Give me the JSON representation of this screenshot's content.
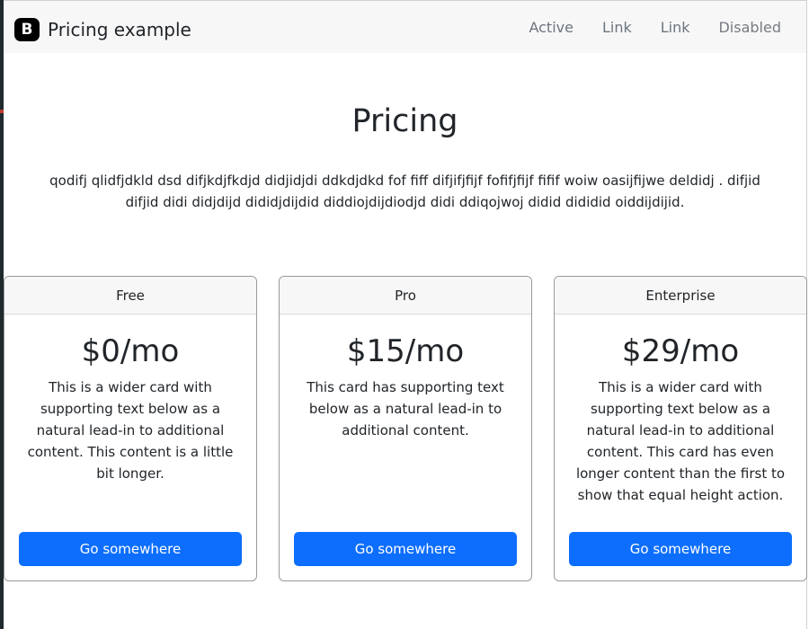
{
  "navbar": {
    "brand_logo_letter": "B",
    "brand_name": "Pricing example",
    "links": [
      {
        "label": "Active"
      },
      {
        "label": "Link"
      },
      {
        "label": "Link"
      },
      {
        "label": "Disabled"
      }
    ]
  },
  "hero": {
    "title": "Pricing",
    "text": "qodifj qlidfjdkld dsd difjkdjfkdjd didjidjdi ddkdjdkd fof fiff difjifjfijf fofifjfijf fifif woiw oasijfijwe deldidj . difjid difjid didi didjdijd dididjdijdid diddiojdijdiodjd didi ddiqojwoj didid dididid oiddijdijid."
  },
  "cards": [
    {
      "header": "Free",
      "price": "$0/mo",
      "description": "This is a wider card with supporting text below as a natural lead-in to additional content. This content is a little bit longer.",
      "button": "Go somewhere"
    },
    {
      "header": "Pro",
      "price": "$15/mo",
      "description": "This card has supporting text below as a natural lead-in to additional content.",
      "button": "Go somewhere"
    },
    {
      "header": "Enterprise",
      "price": "$29/mo",
      "description": "This is a wider card with supporting text below as a natural lead-in to additional content. This card has even longer content than the first to show that equal height action.",
      "button": "Go somewhere"
    }
  ],
  "colors": {
    "primary": "#0d6efd",
    "navbar_bg": "#f7f7f8",
    "text": "#212529",
    "nav_link": "#6c757d"
  }
}
